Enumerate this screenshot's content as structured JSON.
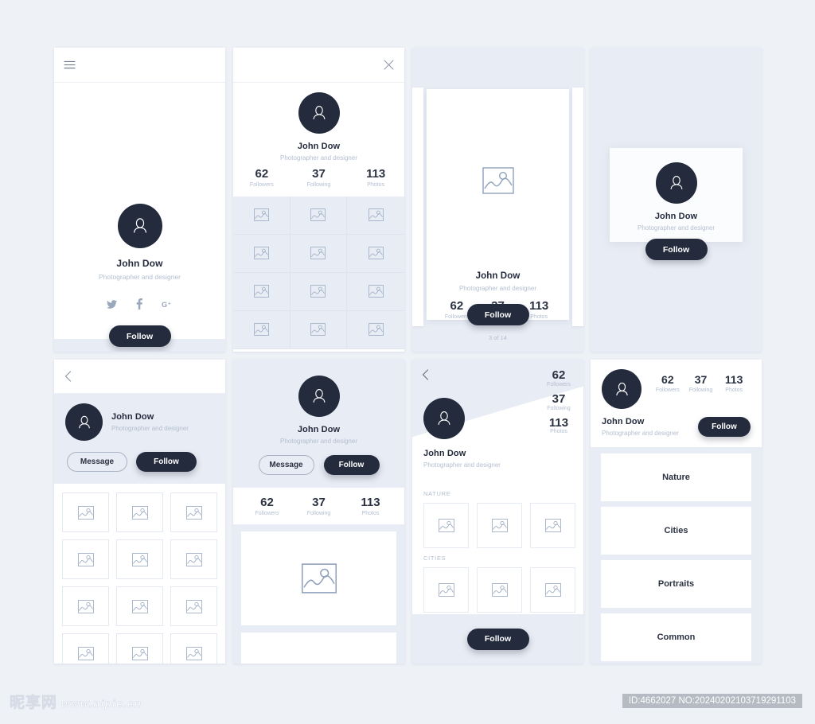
{
  "profile": {
    "name": "John Dow",
    "role": "Photographer and designer",
    "avatar_icon": "user-silhouette-icon"
  },
  "stats": {
    "followers": {
      "value": "62",
      "label": "Followers"
    },
    "following": {
      "value": "37",
      "label": "Following"
    },
    "photos": {
      "value": "113",
      "label": "Photos"
    }
  },
  "actions": {
    "follow": "Follow",
    "message": "Message"
  },
  "icons": {
    "menu": "hamburger-menu-icon",
    "close": "close-icon",
    "back": "chevron-left-icon",
    "twitter": "twitter-icon",
    "facebook": "facebook-icon",
    "googleplus": "google-plus-icon",
    "photo": "image-placeholder-icon"
  },
  "card3": {
    "counter": "3 of 14"
  },
  "card7": {
    "sections": [
      {
        "title": "NATURE"
      },
      {
        "title": "CITIES"
      }
    ]
  },
  "card8": {
    "categories": [
      {
        "label": "Nature"
      },
      {
        "label": "Cities"
      },
      {
        "label": "Portraits"
      },
      {
        "label": "Common"
      }
    ]
  },
  "colors": {
    "dark": "#242b3d",
    "page_bg": "#eef1f6",
    "panel_bg": "#e8ecf4",
    "muted": "#b3bfd1"
  },
  "watermark": {
    "brand": "昵享网",
    "url": "www.nipic.cn",
    "id_text": "ID:4662027 NO:20240202103719291103"
  }
}
